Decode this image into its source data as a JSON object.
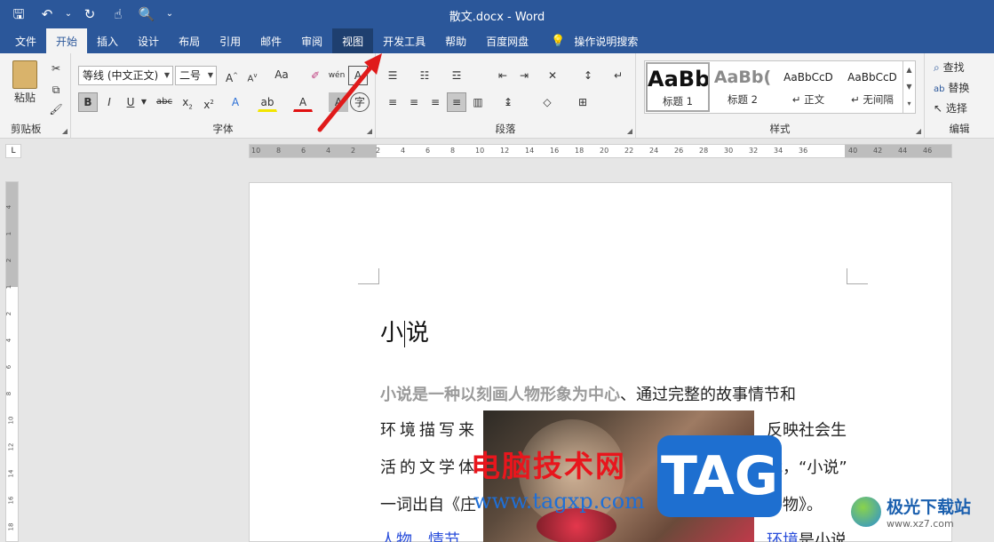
{
  "window": {
    "title": "散文.docx  -  Word"
  },
  "qat": [
    {
      "name": "save-icon",
      "glyph": "🖫"
    },
    {
      "name": "undo-icon",
      "glyph": "↶"
    },
    {
      "name": "undo-dropdown-icon",
      "glyph": "⌄"
    },
    {
      "name": "redo-icon",
      "glyph": "↻"
    },
    {
      "name": "touch-mode-icon",
      "glyph": "☝"
    },
    {
      "name": "print-preview-icon",
      "glyph": "🔍"
    },
    {
      "name": "customize-qat-icon",
      "glyph": "⌄"
    }
  ],
  "tabs": [
    {
      "label": "文件",
      "name": "tab-file"
    },
    {
      "label": "开始",
      "name": "tab-home"
    },
    {
      "label": "插入",
      "name": "tab-insert"
    },
    {
      "label": "设计",
      "name": "tab-design"
    },
    {
      "label": "布局",
      "name": "tab-layout"
    },
    {
      "label": "引用",
      "name": "tab-references"
    },
    {
      "label": "邮件",
      "name": "tab-mailings"
    },
    {
      "label": "审阅",
      "name": "tab-review"
    },
    {
      "label": "视图",
      "name": "tab-view"
    },
    {
      "label": "开发工具",
      "name": "tab-developer"
    },
    {
      "label": "帮助",
      "name": "tab-help"
    },
    {
      "label": "百度网盘",
      "name": "tab-baidu-netdisk"
    }
  ],
  "search": {
    "label": "操作说明搜索"
  },
  "ribbon": {
    "clipboard": {
      "label": "剪贴板",
      "paste": "粘贴"
    },
    "font": {
      "label": "字体",
      "font_name": "等线 (中文正文)",
      "font_size": "二号",
      "change_case": "Aa"
    },
    "paragraph": {
      "label": "段落"
    },
    "styles": {
      "label": "样式",
      "items": [
        {
          "preview": "AaBb",
          "name": "标题 1"
        },
        {
          "preview": "AaBb(",
          "name": "标题 2"
        },
        {
          "preview": "AaBbCcD",
          "name": "↵ 正文"
        },
        {
          "preview": "AaBbCcD",
          "name": "↵ 无间隔"
        }
      ]
    },
    "editing": {
      "label": "编辑",
      "find": "查找",
      "replace": "替换",
      "select": "选择"
    }
  },
  "ruler": {
    "ticks": [
      "10",
      "8",
      "6",
      "4",
      "2",
      "2",
      "4",
      "6",
      "8",
      "10",
      "12",
      "14",
      "16",
      "18",
      "20",
      "22",
      "24",
      "26",
      "28",
      "30",
      "32",
      "34",
      "36",
      "40",
      "42",
      "44",
      "46"
    ],
    "vticks": [
      "4",
      "1",
      "2",
      "1",
      "2",
      "4",
      "6",
      "8",
      "10",
      "12",
      "14",
      "16",
      "18"
    ]
  },
  "document": {
    "title_a": "小",
    "title_b": "说",
    "lines": [
      {
        "gray": "小说是一种以刻画人物形象为中心",
        "rest": "、通过完整的故事情节和"
      },
      {
        "left": "环境描写来",
        "right": "反映社会生"
      },
      {
        "left": "活的文学体",
        "right": "裁，“小说”"
      },
      {
        "left": "一词出自《庄",
        "right": "外物》。"
      },
      {
        "left_link1": "人物",
        "left_sep1": "、",
        "left_link2": "情节",
        "left_sep2": "、",
        "right_link": "环境",
        "right_rest": "是小说"
      }
    ]
  },
  "watermarks": {
    "cn": "电脑技术网",
    "url": "www.tagxp.com",
    "tag": "TAG",
    "logo_cn": "极光下载站",
    "logo_en": "www.xz7.com"
  }
}
